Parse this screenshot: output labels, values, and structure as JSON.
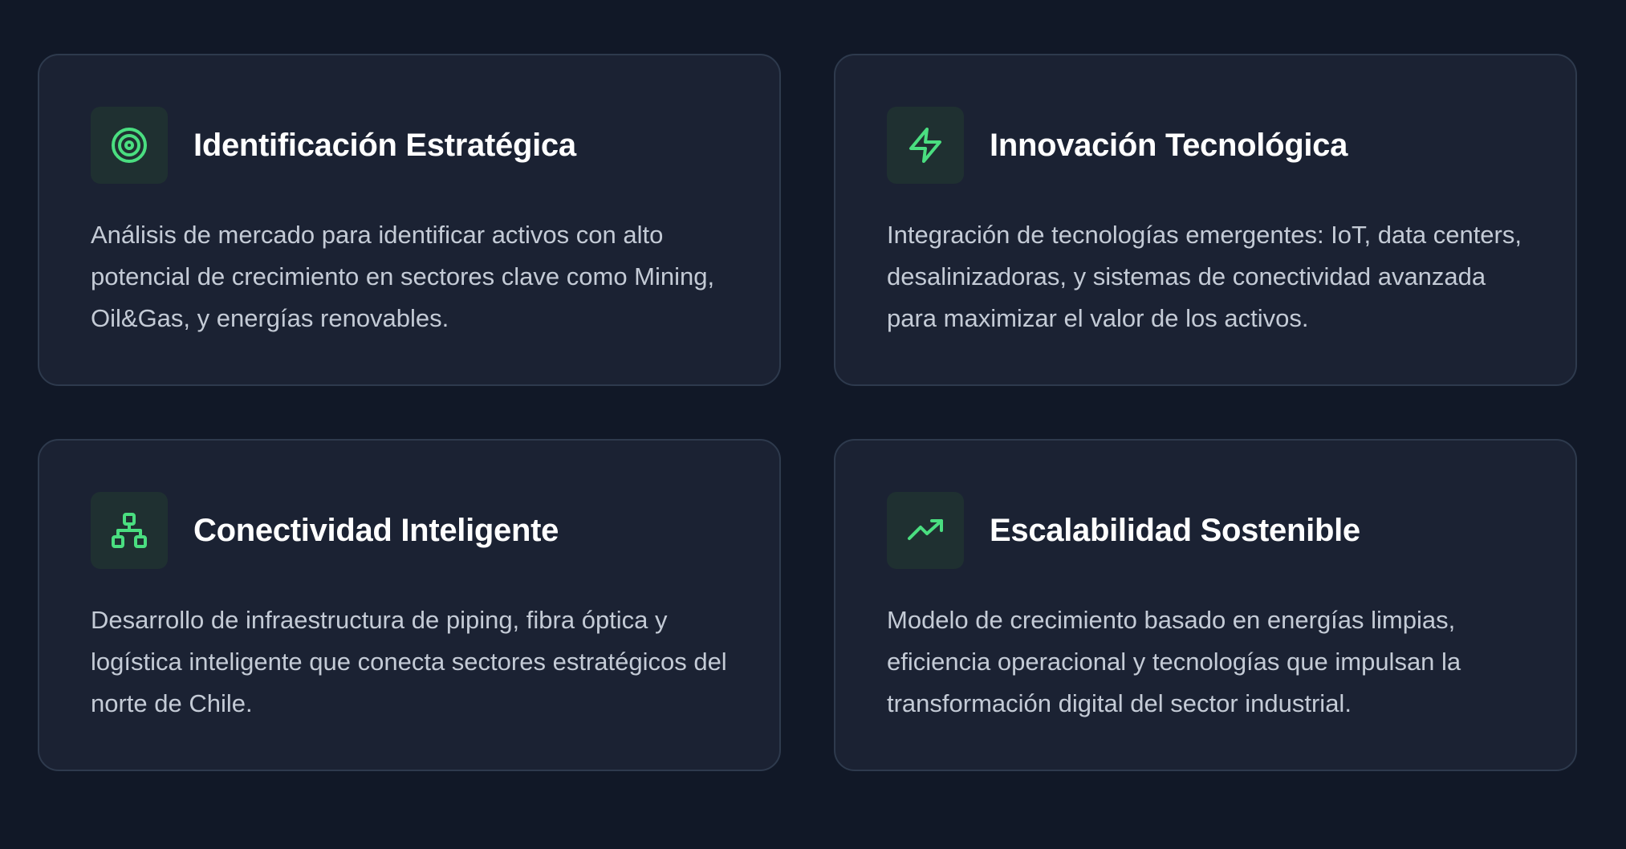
{
  "colors": {
    "background": "#111827",
    "card_background": "#1b2233",
    "card_border": "#2e3a4d",
    "icon_background": "#1f3031",
    "accent": "#4ade80",
    "title": "#ffffff",
    "text": "#c4cbd6"
  },
  "cards": [
    {
      "icon": "target-icon",
      "title": "Identificación Estratégica",
      "description": "Análisis de mercado para identificar activos con alto potencial de crecimiento en sectores clave como Mining, Oil&Gas, y energías renovables."
    },
    {
      "icon": "lightning-bolt-icon",
      "title": "Innovación Tecnológica",
      "description": "Integración de tecnologías emergentes: IoT, data centers, desalinizadoras, y sistemas de conectividad avanzada para maximizar el valor de los activos."
    },
    {
      "icon": "network-hierarchy-icon",
      "title": "Conectividad Inteligente",
      "description": "Desarrollo de infraestructura de piping, fibra óptica y logística inteligente que conecta sectores estratégicos del norte de Chile."
    },
    {
      "icon": "trending-up-icon",
      "title": "Escalabilidad Sostenible",
      "description": "Modelo de crecimiento basado en energías limpias, eficiencia operacional y tecnologías que impulsan la transformación digital del sector industrial."
    }
  ]
}
